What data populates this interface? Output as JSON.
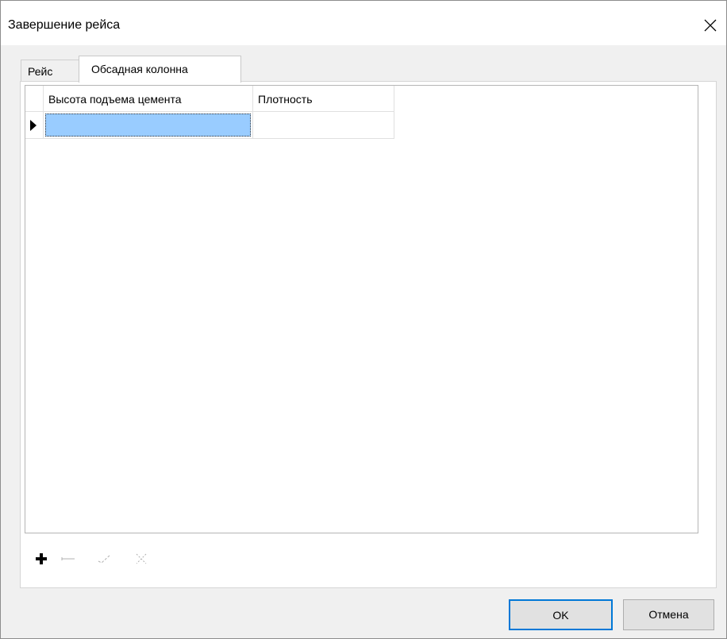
{
  "window": {
    "title": "Завершение рейса"
  },
  "tabs": [
    {
      "label": "Рейс",
      "active": false
    },
    {
      "label": "Обсадная колонна",
      "active": true
    }
  ],
  "grid": {
    "columns": [
      "Высота подъема цемента",
      "Плотность"
    ],
    "rows": [
      {
        "current": true,
        "cells": [
          "",
          ""
        ]
      }
    ]
  },
  "navigator": {
    "buttons": [
      "add-icon",
      "remove-icon",
      "end-edit-icon",
      "cancel-edit-icon"
    ]
  },
  "buttons": {
    "ok_label": "OK",
    "cancel_label": "Отмена"
  },
  "colors": {
    "selection": "#99ccff",
    "default_button_border": "#0078d7"
  }
}
